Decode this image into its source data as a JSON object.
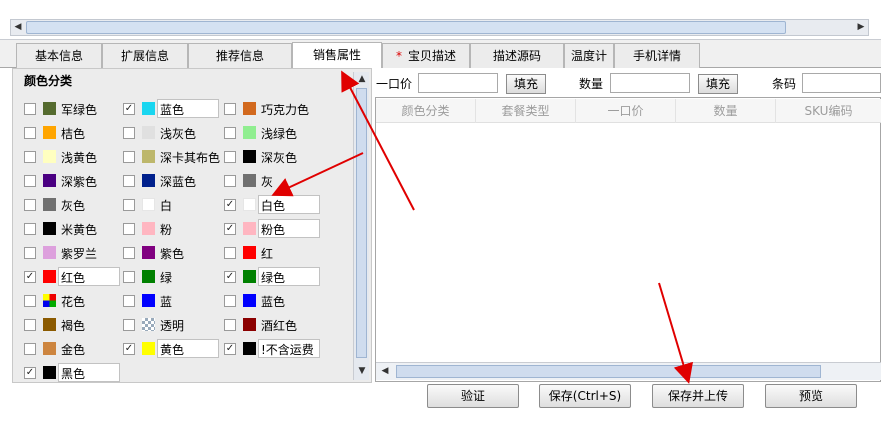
{
  "tabs": [
    {
      "label": "基本信息",
      "active": false,
      "required": false
    },
    {
      "label": "扩展信息",
      "active": false,
      "required": false
    },
    {
      "label": "推荐信息",
      "active": false,
      "required": false
    },
    {
      "label": "销售属性",
      "active": true,
      "required": false
    },
    {
      "label": "宝贝描述",
      "active": false,
      "required": true
    },
    {
      "label": "描述源码",
      "active": false,
      "required": false
    },
    {
      "label": "温度计",
      "active": false,
      "required": false
    },
    {
      "label": "手机详情",
      "active": false,
      "required": false
    }
  ],
  "required_mark": "*",
  "color_section": {
    "title": "颜色分类",
    "rows": [
      [
        {
          "name": "军绿色",
          "color": "#556b2f",
          "checked": false,
          "edit": false
        },
        {
          "name": "蓝色",
          "color": "#1ad6f0",
          "checked": true,
          "edit": true
        },
        {
          "name": "巧克力色",
          "color": "#d2691e",
          "checked": false,
          "edit": false
        }
      ],
      [
        {
          "name": "桔色",
          "color": "#ffa500",
          "checked": false,
          "edit": false
        },
        {
          "name": "浅灰色",
          "color": "#e0e0e0",
          "checked": false,
          "edit": false
        },
        {
          "name": "浅绿色",
          "color": "#90ee90",
          "checked": false,
          "edit": false
        }
      ],
      [
        {
          "name": "浅黄色",
          "color": "#ffffc0",
          "checked": false,
          "edit": false
        },
        {
          "name": "深卡其布色",
          "color": "#bdb76b",
          "checked": false,
          "edit": false
        },
        {
          "name": "深灰色",
          "color": "#000000",
          "checked": false,
          "edit": false
        }
      ],
      [
        {
          "name": "深紫色",
          "color": "#4b0082",
          "checked": false,
          "edit": false
        },
        {
          "name": "深蓝色",
          "color": "#00208c",
          "checked": false,
          "edit": false
        },
        {
          "name": "灰",
          "color": "#707070",
          "checked": false,
          "edit": false
        }
      ],
      [
        {
          "name": "灰色",
          "color": "#707070",
          "checked": false,
          "edit": false
        },
        {
          "name": "白",
          "color": "#ffffff",
          "checked": false,
          "edit": false
        },
        {
          "name": "白色",
          "color": "#ffffff",
          "checked": true,
          "edit": true
        }
      ],
      [
        {
          "name": "米黄色",
          "color": "#000000",
          "checked": false,
          "edit": false
        },
        {
          "name": "粉",
          "color": "#ffb6c1",
          "checked": false,
          "edit": false
        },
        {
          "name": "粉色",
          "color": "#ffb6c1",
          "checked": true,
          "edit": true
        }
      ],
      [
        {
          "name": "紫罗兰",
          "color": "#dda0dd",
          "checked": false,
          "edit": false
        },
        {
          "name": "紫色",
          "color": "#800080",
          "checked": false,
          "edit": false
        },
        {
          "name": "红",
          "color": "#ff0000",
          "checked": false,
          "edit": false
        }
      ],
      [
        {
          "name": "红色",
          "color": "#ff0000",
          "checked": true,
          "edit": true
        },
        {
          "name": "绿",
          "color": "#008000",
          "checked": false,
          "edit": false
        },
        {
          "name": "绿色",
          "color": "#008000",
          "checked": true,
          "edit": true
        }
      ],
      [
        {
          "name": "花色",
          "color": "multi",
          "checked": false,
          "edit": false
        },
        {
          "name": "蓝",
          "color": "#0000ff",
          "checked": false,
          "edit": false
        },
        {
          "name": "蓝色",
          "color": "#0000ff",
          "checked": false,
          "edit": false
        }
      ],
      [
        {
          "name": "褐色",
          "color": "#8b5a00",
          "checked": false,
          "edit": false
        },
        {
          "name": "透明",
          "color": "checker",
          "checked": false,
          "edit": false
        },
        {
          "name": "酒红色",
          "color": "#8b0000",
          "checked": false,
          "edit": false
        }
      ],
      [
        {
          "name": "金色",
          "color": "#cd853f",
          "checked": false,
          "edit": false
        },
        {
          "name": "黄色",
          "color": "#ffff00",
          "checked": true,
          "edit": true
        },
        {
          "name": "!不含运费",
          "color": "#000000",
          "checked": true,
          "edit": true
        }
      ],
      [
        {
          "name": "黑色",
          "color": "#000000",
          "checked": true,
          "edit": true
        }
      ]
    ]
  },
  "price_bar": {
    "price_label": "一口价",
    "fill_label": "填充",
    "qty_label": "数量",
    "fill_label2": "填充",
    "barcode_label": "条码"
  },
  "grid": {
    "columns": [
      "颜色分类",
      "套餐类型",
      "一口价",
      "数量",
      "SKU编码"
    ]
  },
  "bottom_buttons": {
    "verify": "验证",
    "save": "保存(Ctrl+S)",
    "save_upload": "保存并上传",
    "preview": "预览"
  },
  "annotation_color": "#e00000"
}
